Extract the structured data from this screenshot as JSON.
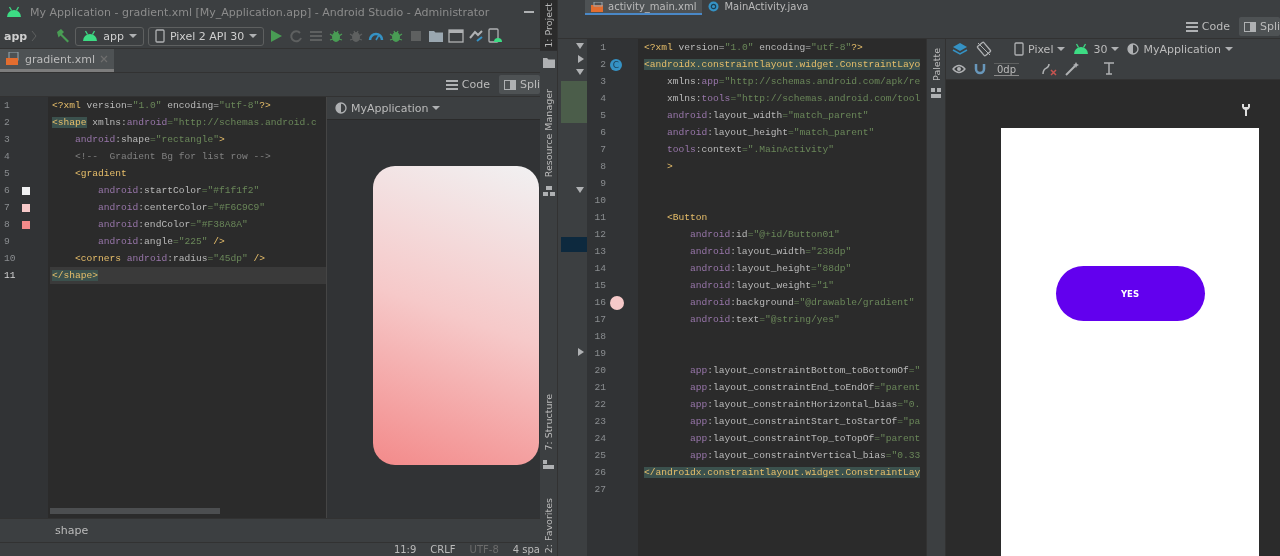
{
  "left_window": {
    "title": "My Application - gradient.xml [My_Application.app] - Android Studio - Administrator",
    "breadcrumb": "app",
    "run_config": "app",
    "device": "Pixel 2 API 30",
    "tabs": [
      {
        "label": "gradient.xml",
        "selected": true
      }
    ],
    "view_modes": [
      {
        "label": "Code",
        "selected": false
      },
      {
        "label": "Spli",
        "selected": true
      }
    ],
    "code_lines": [
      {
        "number": "1",
        "current": false,
        "segments": [
          {
            "kind": "tag",
            "text": "<?xml"
          },
          {
            "kind": "attr",
            "text": " version="
          },
          {
            "kind": "value",
            "text": "\"1.0\""
          },
          {
            "kind": "attr",
            "text": " encoding="
          },
          {
            "kind": "value",
            "text": "\"utf-8\""
          },
          {
            "kind": "tag",
            "text": "?>"
          }
        ]
      },
      {
        "number": "2",
        "current": false,
        "segments": [
          {
            "kind": "match",
            "text": "<shape"
          },
          {
            "kind": "attr",
            "text": " xmlns:"
          },
          {
            "kind": "ns",
            "text": "android"
          },
          {
            "kind": "value",
            "text": "=\"http://schemas.android.c"
          }
        ]
      },
      {
        "number": "3",
        "current": false,
        "segments": [
          {
            "kind": "ns",
            "text": "    android"
          },
          {
            "kind": "attr",
            "text": ":shape"
          },
          {
            "kind": "value",
            "text": "=\"rectangle\""
          },
          {
            "kind": "tag",
            "text": ">"
          }
        ]
      },
      {
        "number": "4",
        "current": false,
        "segments": [
          {
            "kind": "comment",
            "text": "    <!--  Gradient Bg for list row -->"
          }
        ]
      },
      {
        "number": "5",
        "current": false,
        "segments": [
          {
            "kind": "tag",
            "text": "    <gradient"
          }
        ]
      },
      {
        "number": "6",
        "current": false,
        "color": "#f1f1f2",
        "segments": [
          {
            "kind": "ns",
            "text": "        android"
          },
          {
            "kind": "attr",
            "text": ":startColor"
          },
          {
            "kind": "value",
            "text": "=\"#f1f1f2\""
          }
        ]
      },
      {
        "number": "7",
        "current": false,
        "color": "#f6c9c9",
        "segments": [
          {
            "kind": "ns",
            "text": "        android"
          },
          {
            "kind": "attr",
            "text": ":centerColor"
          },
          {
            "kind": "value",
            "text": "=\"#F6C9C9\""
          }
        ]
      },
      {
        "number": "8",
        "current": false,
        "color": "#f38a8a",
        "segments": [
          {
            "kind": "ns",
            "text": "        android"
          },
          {
            "kind": "attr",
            "text": ":endColor"
          },
          {
            "kind": "value",
            "text": "=\"#F38A8A\""
          }
        ]
      },
      {
        "number": "9",
        "current": false,
        "segments": [
          {
            "kind": "ns",
            "text": "        android"
          },
          {
            "kind": "attr",
            "text": ":angle"
          },
          {
            "kind": "value",
            "text": "=\"225\""
          },
          {
            "kind": "tag",
            "text": " />"
          }
        ]
      },
      {
        "number": "10",
        "current": false,
        "segments": [
          {
            "kind": "tag",
            "text": "    <corners"
          },
          {
            "kind": "ns",
            "text": " android"
          },
          {
            "kind": "attr",
            "text": ":radius"
          },
          {
            "kind": "value",
            "text": "=\"45dp\""
          },
          {
            "kind": "tag",
            "text": " />"
          }
        ]
      },
      {
        "number": "11",
        "current": true,
        "segments": [
          {
            "kind": "match",
            "text": "</shape>"
          }
        ]
      }
    ],
    "preview": {
      "theme": "MyApplication"
    },
    "path": "shape",
    "status_bar": [
      {
        "text": "11:9",
        "disabled": false
      },
      {
        "text": "CRLF",
        "disabled": false
      },
      {
        "text": "UTF-8",
        "disabled": true
      },
      {
        "text": "4 spa",
        "disabled": false
      }
    ]
  },
  "right_window": {
    "tool_strip": {
      "top": [
        {
          "label": "1: Project",
          "selected": true
        },
        {
          "label": "Resource Manager",
          "selected": false
        }
      ],
      "bottom": [
        {
          "label": "7: Structure",
          "selected": false
        },
        {
          "label": "2: Favorites",
          "selected": false
        }
      ]
    },
    "tabs": [
      {
        "label": "activity_main.xml",
        "selected": true
      },
      {
        "label": "MainActivity.java",
        "selected": false
      }
    ],
    "view_modes": [
      {
        "label": "Code",
        "selected": false
      },
      {
        "label": "Spli",
        "selected": true
      }
    ],
    "code_lines": [
      {
        "number": "1",
        "segments": [
          {
            "kind": "tag",
            "text": "<?xml"
          },
          {
            "kind": "attr",
            "text": " version="
          },
          {
            "kind": "value",
            "text": "\"1.0\""
          },
          {
            "kind": "attr",
            "text": " encoding="
          },
          {
            "kind": "value",
            "text": "\"utf-8\""
          },
          {
            "kind": "tag",
            "text": "?>"
          }
        ]
      },
      {
        "number": "2",
        "badge": "C",
        "segments": [
          {
            "kind": "match",
            "text": "<androidx.constraintlayout.widget.ConstraintLayo"
          }
        ]
      },
      {
        "number": "3",
        "segments": [
          {
            "kind": "attr",
            "text": "    xmlns:"
          },
          {
            "kind": "ns",
            "text": "app"
          },
          {
            "kind": "value",
            "text": "=\"http://schemas.android.com/apk/re"
          }
        ]
      },
      {
        "number": "4",
        "segments": [
          {
            "kind": "attr",
            "text": "    xmlns:"
          },
          {
            "kind": "ns",
            "text": "tools"
          },
          {
            "kind": "value",
            "text": "=\"http://schemas.android.com/tool"
          }
        ]
      },
      {
        "number": "5",
        "segments": [
          {
            "kind": "ns",
            "text": "    android"
          },
          {
            "kind": "attr",
            "text": ":layout_width"
          },
          {
            "kind": "value",
            "text": "=\"match_parent\""
          }
        ]
      },
      {
        "number": "6",
        "segments": [
          {
            "kind": "ns",
            "text": "    android"
          },
          {
            "kind": "attr",
            "text": ":layout_height"
          },
          {
            "kind": "value",
            "text": "=\"match_parent\""
          }
        ]
      },
      {
        "number": "7",
        "segments": [
          {
            "kind": "ns",
            "text": "    tools"
          },
          {
            "kind": "attr",
            "text": ":context"
          },
          {
            "kind": "value",
            "text": "=\".MainActivity\""
          }
        ]
      },
      {
        "number": "8",
        "segments": [
          {
            "kind": "tag",
            "text": "    >"
          }
        ]
      },
      {
        "number": "9"
      },
      {
        "number": "10"
      },
      {
        "number": "11",
        "segments": [
          {
            "kind": "tag",
            "text": "    <Button"
          }
        ]
      },
      {
        "number": "12",
        "segments": [
          {
            "kind": "ns",
            "text": "        android"
          },
          {
            "kind": "attr",
            "text": ":id"
          },
          {
            "kind": "value",
            "text": "=\"@+id/Button01\""
          }
        ]
      },
      {
        "number": "13",
        "segments": [
          {
            "kind": "ns",
            "text": "        android"
          },
          {
            "kind": "attr",
            "text": ":layout_width"
          },
          {
            "kind": "value",
            "text": "=\"238dp\""
          }
        ]
      },
      {
        "number": "14",
        "segments": [
          {
            "kind": "ns",
            "text": "        android"
          },
          {
            "kind": "attr",
            "text": ":layout_height"
          },
          {
            "kind": "value",
            "text": "=\"88dp\""
          }
        ]
      },
      {
        "number": "15",
        "segments": [
          {
            "kind": "ns",
            "text": "        android"
          },
          {
            "kind": "attr",
            "text": ":layout_weight"
          },
          {
            "kind": "value",
            "text": "=\"1\""
          }
        ]
      },
      {
        "number": "16",
        "color": "#f6c9c9",
        "segments": [
          {
            "kind": "ns",
            "text": "        android"
          },
          {
            "kind": "attr",
            "text": ":background"
          },
          {
            "kind": "value",
            "text": "=\"@drawable/gradient\""
          }
        ]
      },
      {
        "number": "17",
        "segments": [
          {
            "kind": "ns",
            "text": "        android"
          },
          {
            "kind": "attr",
            "text": ":text"
          },
          {
            "kind": "value",
            "text": "=\"@string/yes\""
          }
        ]
      },
      {
        "number": "18"
      },
      {
        "number": "19"
      },
      {
        "number": "20",
        "segments": [
          {
            "kind": "ns",
            "text": "        app"
          },
          {
            "kind": "attr",
            "text": ":layout_constraintBottom_toBottomOf"
          },
          {
            "kind": "value",
            "text": "=\""
          }
        ]
      },
      {
        "number": "21",
        "segments": [
          {
            "kind": "ns",
            "text": "        app"
          },
          {
            "kind": "attr",
            "text": ":layout_constraintEnd_toEndOf"
          },
          {
            "kind": "value",
            "text": "=\"parent"
          }
        ]
      },
      {
        "number": "22",
        "segments": [
          {
            "kind": "ns",
            "text": "        app"
          },
          {
            "kind": "attr",
            "text": ":layout_constraintHorizontal_bias"
          },
          {
            "kind": "value",
            "text": "=\"0."
          }
        ]
      },
      {
        "number": "23",
        "segments": [
          {
            "kind": "ns",
            "text": "        app"
          },
          {
            "kind": "attr",
            "text": ":layout_constraintStart_toStartOf"
          },
          {
            "kind": "value",
            "text": "=\"pa"
          }
        ]
      },
      {
        "number": "24",
        "segments": [
          {
            "kind": "ns",
            "text": "        app"
          },
          {
            "kind": "attr",
            "text": ":layout_constraintTop_toTopOf"
          },
          {
            "kind": "value",
            "text": "=\"parent"
          }
        ]
      },
      {
        "number": "25",
        "segments": [
          {
            "kind": "ns",
            "text": "        app"
          },
          {
            "kind": "attr",
            "text": ":layout_constraintVertical_bias"
          },
          {
            "kind": "value",
            "text": "=\"0.33"
          }
        ]
      },
      {
        "number": "26",
        "segments": [
          {
            "kind": "match",
            "text": "</androidx.constraintlayout.widget.ConstraintLay"
          }
        ]
      },
      {
        "number": "27"
      }
    ],
    "palette_label": "Palette",
    "design_toolbar": {
      "device": "Pixel",
      "api": "30",
      "theme": "MyApplication",
      "margin": "0dp"
    },
    "device_preview": {
      "button_label": "YES"
    }
  }
}
